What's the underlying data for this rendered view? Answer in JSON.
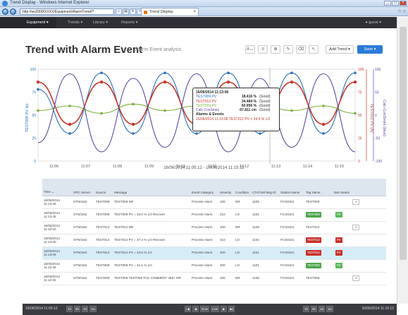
{
  "window": {
    "title": "Trend Display - Windows Internet Explorer",
    "url": "http://ws2008/XXXX/Equipment/AlarmTrend/?",
    "tab_label": "Trend Display"
  },
  "nav": {
    "items": [
      "Equipment",
      "Trends",
      "Library",
      "Reports"
    ],
    "user": "guest"
  },
  "page": {
    "title": "Trend with Alarm Event",
    "subtitle": "Alarm Event analysis",
    "add_trend_label": "Add Trend",
    "save_label": "Save",
    "time_range": "16/06/2014 11:05:12 - 16/06/2014 11:15:12"
  },
  "colors": {
    "blue": "#2f6fb8",
    "red": "#c0392b",
    "green": "#7ab03c",
    "purple": "#5b4aa0",
    "accent": "#2b7bd6"
  },
  "chart_data": {
    "type": "line",
    "x_labels": [
      "11:06",
      "11:07",
      "11:08",
      "11:09",
      "11:10",
      "11:11",
      "11:12",
      "11:13",
      "11:14",
      "11:15"
    ],
    "left_axis": {
      "label": "TEST009 PV (b)",
      "ticks": [
        0,
        25,
        50,
        75,
        100
      ]
    },
    "right_axes": [
      {
        "label": "TEST012 PV (A)",
        "ticks": [
          0,
          25,
          50,
          75,
          100
        ]
      },
      {
        "label": "Calc-CosSines (blue)",
        "ticks": [
          -100,
          -50,
          0,
          50,
          100
        ]
      }
    ],
    "series": [
      {
        "name": "TEST009.PV",
        "color": "blue",
        "values": [
          78,
          30,
          96,
          30,
          96,
          30,
          96,
          30,
          96,
          30,
          96
        ]
      },
      {
        "name": "TEST012.PV",
        "color": "red",
        "values": [
          86,
          40,
          86,
          40,
          86,
          40,
          86,
          40,
          86,
          40,
          86
        ]
      },
      {
        "name": "TEST009.PV",
        "color": "green",
        "values": [
          55,
          60,
          52,
          62,
          55,
          60,
          52,
          62,
          55,
          60,
          52
        ]
      },
      {
        "name": "Calc-CosSines",
        "color": "purple",
        "values": [
          20,
          95,
          10,
          90,
          15,
          95,
          10,
          90,
          15,
          95,
          10
        ]
      }
    ]
  },
  "tooltip": {
    "header": "16/06/2014 11:13:06",
    "rows": [
      {
        "name": "TEST009.PV",
        "value": "18.416 %",
        "quality": "(Good)"
      },
      {
        "name": "TEST012.PV",
        "value": "34.484 %",
        "quality": "(Good)"
      },
      {
        "name": "TEST009.PV",
        "value": "60.956 %",
        "quality": "(Good)"
      },
      {
        "name": "Calc-CosSines",
        "value": "-57.811 cm",
        "quality": "(Good)"
      }
    ],
    "alarms_header": "Alarms & Events",
    "alarm_text": "16/06/2014 11:13:06 TEST012 PV = 34.5 % LO"
  },
  "table": {
    "headers": [
      "Time",
      "OPC Server",
      "Source",
      "Message",
      "Event Category",
      "Severity",
      "Condition",
      "CTATUM Msg ID",
      "Station Name",
      "Tag Name",
      "Item Name",
      ""
    ],
    "rows": [
      {
        "time": "16/06/2014 11:13:45",
        "server": "STN0162",
        "source": "TEST009",
        "message": "TEST009 NR",
        "category": "Process Alarm",
        "severity": "100",
        "condition": "NR",
        "msgid": "1106",
        "station": "FCS0101",
        "tag": "TEST009",
        "tag_color": "none",
        "item": "",
        "trend": true,
        "hl": false
      },
      {
        "time": "16/06/2014 11:13:45",
        "server": "STN0162",
        "source": "TEST009",
        "message": "TEST009 PV = 34.0 % LO Recover",
        "category": "Process Alarm",
        "severity": "210",
        "condition": "LO",
        "msgid": "1102",
        "station": "FCS0101",
        "tag": "TEST009",
        "tag_color": "green",
        "item": "PV",
        "trend": false,
        "hl": false
      },
      {
        "time": "16/06/2014 11:13:30",
        "server": "STN0162",
        "source": "TEST012",
        "message": "TEST012 NR",
        "category": "Process Alarm",
        "severity": "100",
        "condition": "NR",
        "msgid": "1106",
        "station": "FCS0101",
        "tag": "TEST012",
        "tag_color": "none",
        "item": "",
        "trend": true,
        "hl": false
      },
      {
        "time": "16/06/2014 11:13:30",
        "server": "STN0162",
        "source": "TEST012",
        "message": "TEST012 PV = 37.4 % LO Recover",
        "category": "Process Alarm",
        "severity": "210",
        "condition": "LO",
        "msgid": "1102",
        "station": "FCS0101",
        "tag": "TEST012",
        "tag_color": "red",
        "item": "PV",
        "trend": false,
        "hl": false
      },
      {
        "time": "16/06/2014 11:13:06",
        "server": "STN0162",
        "source": "TEST012",
        "message": "TEST012 PV = 34.5 % LO",
        "category": "Process Alarm",
        "severity": "400",
        "condition": "LO",
        "msgid": "1101",
        "station": "FCS0101",
        "tag": "TEST012",
        "tag_color": "red",
        "item": "PV",
        "trend": false,
        "hl": true
      },
      {
        "time": "16/06/2014 11:12:46",
        "server": "STN0162",
        "source": "TEST009",
        "message": "TEST009 PV = 31.1 % LO",
        "category": "Process Alarm",
        "severity": "400",
        "condition": "LO",
        "msgid": "1101",
        "station": "FCS0101",
        "tag": "TEST009",
        "tag_color": "green",
        "item": "PV",
        "trend": false,
        "hl": false
      },
      {
        "time": "16/06/2014 11:12:45",
        "server": "STN0162",
        "source": "TEST009",
        "message": "TEST009 TEST009 TAG COMMENT 456+ NR",
        "category": "Process Alarm",
        "severity": "100",
        "condition": "NR",
        "msgid": "1106",
        "station": "FCS0101",
        "tag": "TEST009",
        "tag_color": "none",
        "item": "",
        "trend": true,
        "hl": false
      }
    ]
  },
  "bottom": {
    "left_time": "16/06/2014 11:05:12",
    "right_time": "16/06/2014 11:15:12",
    "left_buttons": [
      "1h",
      "5h",
      "1d",
      "1w"
    ],
    "center_buttons": [
      "|◀",
      "◀",
      "Now",
      "Live",
      "▶",
      "▶|"
    ],
    "right_buttons": [
      "1h",
      "5h",
      "1d",
      "1w"
    ]
  }
}
